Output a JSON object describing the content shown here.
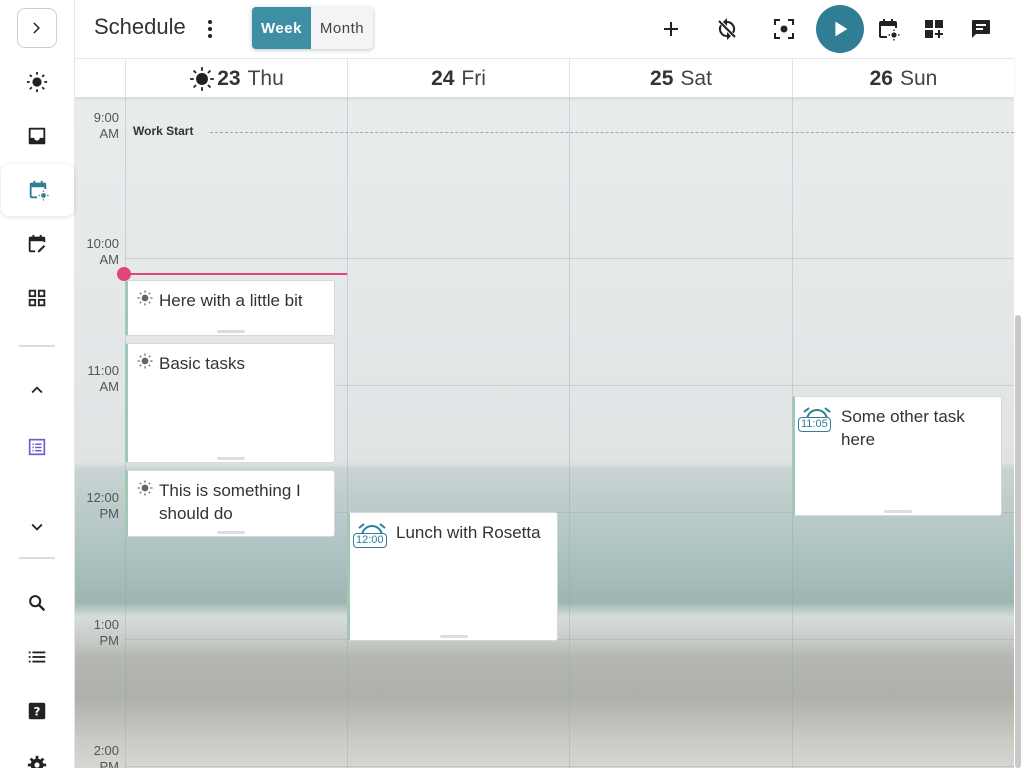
{
  "nav": {
    "toggle_icon": "chevron-right-icon",
    "items": [
      {
        "name": "today",
        "icon": "sun-icon"
      },
      {
        "name": "inbox",
        "icon": "inbox-icon"
      },
      {
        "name": "schedule",
        "icon": "calendar-sun-icon",
        "active": true
      },
      {
        "name": "planner",
        "icon": "calendar-edit-icon"
      },
      {
        "name": "boards",
        "icon": "grid-icon"
      },
      {
        "name": "collapse",
        "icon": "chevron-up-icon"
      },
      {
        "name": "project",
        "icon": "list-box-icon"
      },
      {
        "name": "expand",
        "icon": "chevron-down-icon"
      },
      {
        "name": "search",
        "icon": "search-icon"
      },
      {
        "name": "list",
        "icon": "list-icon"
      },
      {
        "name": "help",
        "icon": "help-icon"
      },
      {
        "name": "settings",
        "icon": "gear-icon"
      }
    ]
  },
  "header": {
    "title": "Schedule",
    "view_week": "Week",
    "view_month": "Month",
    "accent": "#3e8ea4",
    "actions": [
      "plus-icon",
      "sync-off-icon",
      "focus-icon",
      "play-icon",
      "calendar-sun-icon",
      "add-widget-icon",
      "comment-icon"
    ]
  },
  "days": [
    {
      "num": "23",
      "name": "Thu",
      "today": true
    },
    {
      "num": "24",
      "name": "Fri"
    },
    {
      "num": "25",
      "name": "Sat"
    },
    {
      "num": "26",
      "name": "Sun"
    }
  ],
  "times": [
    {
      "time": "9:00",
      "ampm": "AM"
    },
    {
      "time": "10:00",
      "ampm": "AM"
    },
    {
      "time": "11:00",
      "ampm": "AM"
    },
    {
      "time": "12:00",
      "ampm": "PM"
    },
    {
      "time": "1:00",
      "ampm": "PM"
    },
    {
      "time": "2:00",
      "ampm": "PM"
    }
  ],
  "work_start": "Work Start",
  "tasks": [
    {
      "text": "Here with a little bit",
      "icon": "sun-icon"
    },
    {
      "text": "Basic tasks",
      "icon": "sun-icon"
    },
    {
      "text": "This is something I should do",
      "icon": "sun-icon"
    }
  ],
  "events": [
    {
      "text": "Lunch with Rosetta",
      "time": "12:00",
      "icon": "alarm-icon"
    },
    {
      "text": "Some other task here",
      "time": "11:05",
      "icon": "alarm-icon"
    }
  ]
}
